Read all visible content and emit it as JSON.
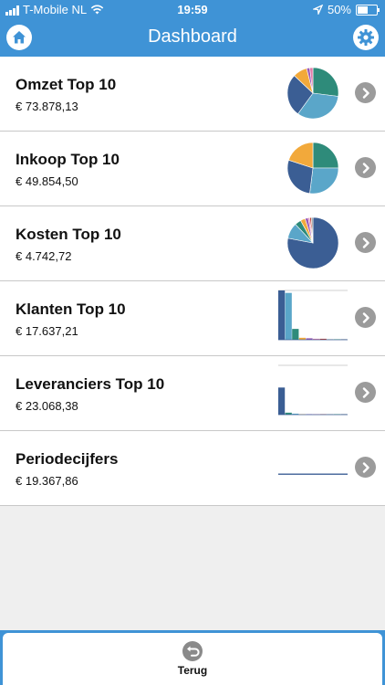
{
  "status": {
    "carrier": "T-Mobile NL",
    "time": "19:59",
    "battery": "50%"
  },
  "nav": {
    "title": "Dashboard"
  },
  "rows": [
    {
      "title": "Omzet Top 10",
      "amount": "€ 73.878,13"
    },
    {
      "title": "Inkoop Top 10",
      "amount": "€ 49.854,50"
    },
    {
      "title": "Kosten Top 10",
      "amount": "€ 4.742,72"
    },
    {
      "title": "Klanten Top 10",
      "amount": "€ 17.637,21"
    },
    {
      "title": "Leveranciers Top 10",
      "amount": "€ 23.068,38"
    },
    {
      "title": "Periodecijfers",
      "amount": "€ 19.367,86"
    }
  ],
  "bottom": {
    "back_label": "Terug"
  },
  "colors": {
    "accent": "#3f93d6",
    "chevron": "#9b9b9b"
  },
  "chart_data": [
    {
      "type": "pie",
      "values": [
        27,
        33,
        27,
        9,
        2,
        2
      ],
      "colors": [
        "#2e8b7a",
        "#5aa6c9",
        "#3b5e94",
        "#f2a93b",
        "#9b59b6",
        "#e07aa8"
      ]
    },
    {
      "type": "pie",
      "values": [
        25,
        27,
        28,
        20
      ],
      "colors": [
        "#2e8b7a",
        "#5aa6c9",
        "#3b5e94",
        "#f2a93b"
      ]
    },
    {
      "type": "pie",
      "values": [
        78,
        10,
        4,
        3,
        2,
        1,
        1,
        1
      ],
      "colors": [
        "#3b5e94",
        "#5aa6c9",
        "#2e8b7a",
        "#f2a93b",
        "#9b59b6",
        "#e07aa8",
        "#c0392b",
        "#7f8c8d"
      ]
    },
    {
      "type": "bar",
      "values": [
        100,
        95,
        22,
        4,
        3,
        2,
        2,
        1,
        1,
        1
      ],
      "colors": [
        "#3b5e94",
        "#5aa6c9",
        "#2e8b7a",
        "#f2a93b",
        "#9b59b6",
        "#e07aa8",
        "#c0392b",
        "#7f8c8d",
        "#27ae60",
        "#34495e"
      ]
    },
    {
      "type": "bar",
      "values": [
        55,
        4,
        2,
        1,
        1,
        1,
        1,
        1,
        1,
        1
      ],
      "colors": [
        "#3b5e94",
        "#2e8b7a",
        "#5aa6c9",
        "#f2a93b",
        "#9b59b6",
        "#e07aa8",
        "#c0392b",
        "#7f8c8d",
        "#27ae60",
        "#34495e"
      ]
    },
    {
      "type": "line",
      "values": [
        2,
        2,
        2,
        2,
        2,
        2,
        2,
        2,
        2,
        2,
        2,
        2
      ],
      "colors": [
        "#3b5e94"
      ]
    }
  ]
}
